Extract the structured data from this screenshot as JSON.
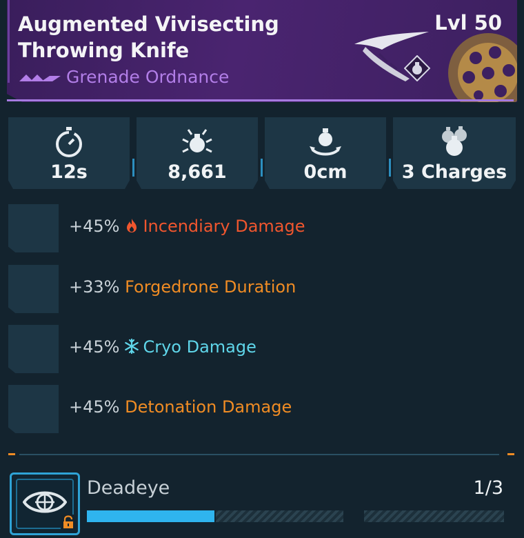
{
  "item": {
    "title": "Augmented Vivisecting Throwing Knife",
    "level_label": "Lvl 50",
    "type": "Grenade Ordnance",
    "rarity_color": "#b27ee8"
  },
  "stats": [
    {
      "icon": "stopwatch-icon",
      "value": "12s"
    },
    {
      "icon": "explosion-damage-icon",
      "value": "8,661"
    },
    {
      "icon": "grenade-radius-icon",
      "value": "0cm"
    },
    {
      "icon": "grenade-charges-icon",
      "value": "3 Charges"
    }
  ],
  "perks": [
    {
      "percent": "+45%",
      "icon": "fire-icon",
      "name": "Incendiary Damage",
      "color": "#f0562e"
    },
    {
      "percent": "+33%",
      "icon": "",
      "name": "Forgedrone Duration",
      "color": "#f08c24"
    },
    {
      "percent": "+45%",
      "icon": "snowflake-icon",
      "name": "Cryo Damage",
      "color": "#5fd6ea"
    },
    {
      "percent": "+45%",
      "icon": "",
      "name": "Detonation Damage",
      "color": "#f08c24"
    }
  ],
  "skill": {
    "name": "Deadeye",
    "count": "1/3",
    "points": 1,
    "max_points": 3,
    "icon": "eye-target-icon",
    "locked_icon": "lock-icon"
  }
}
